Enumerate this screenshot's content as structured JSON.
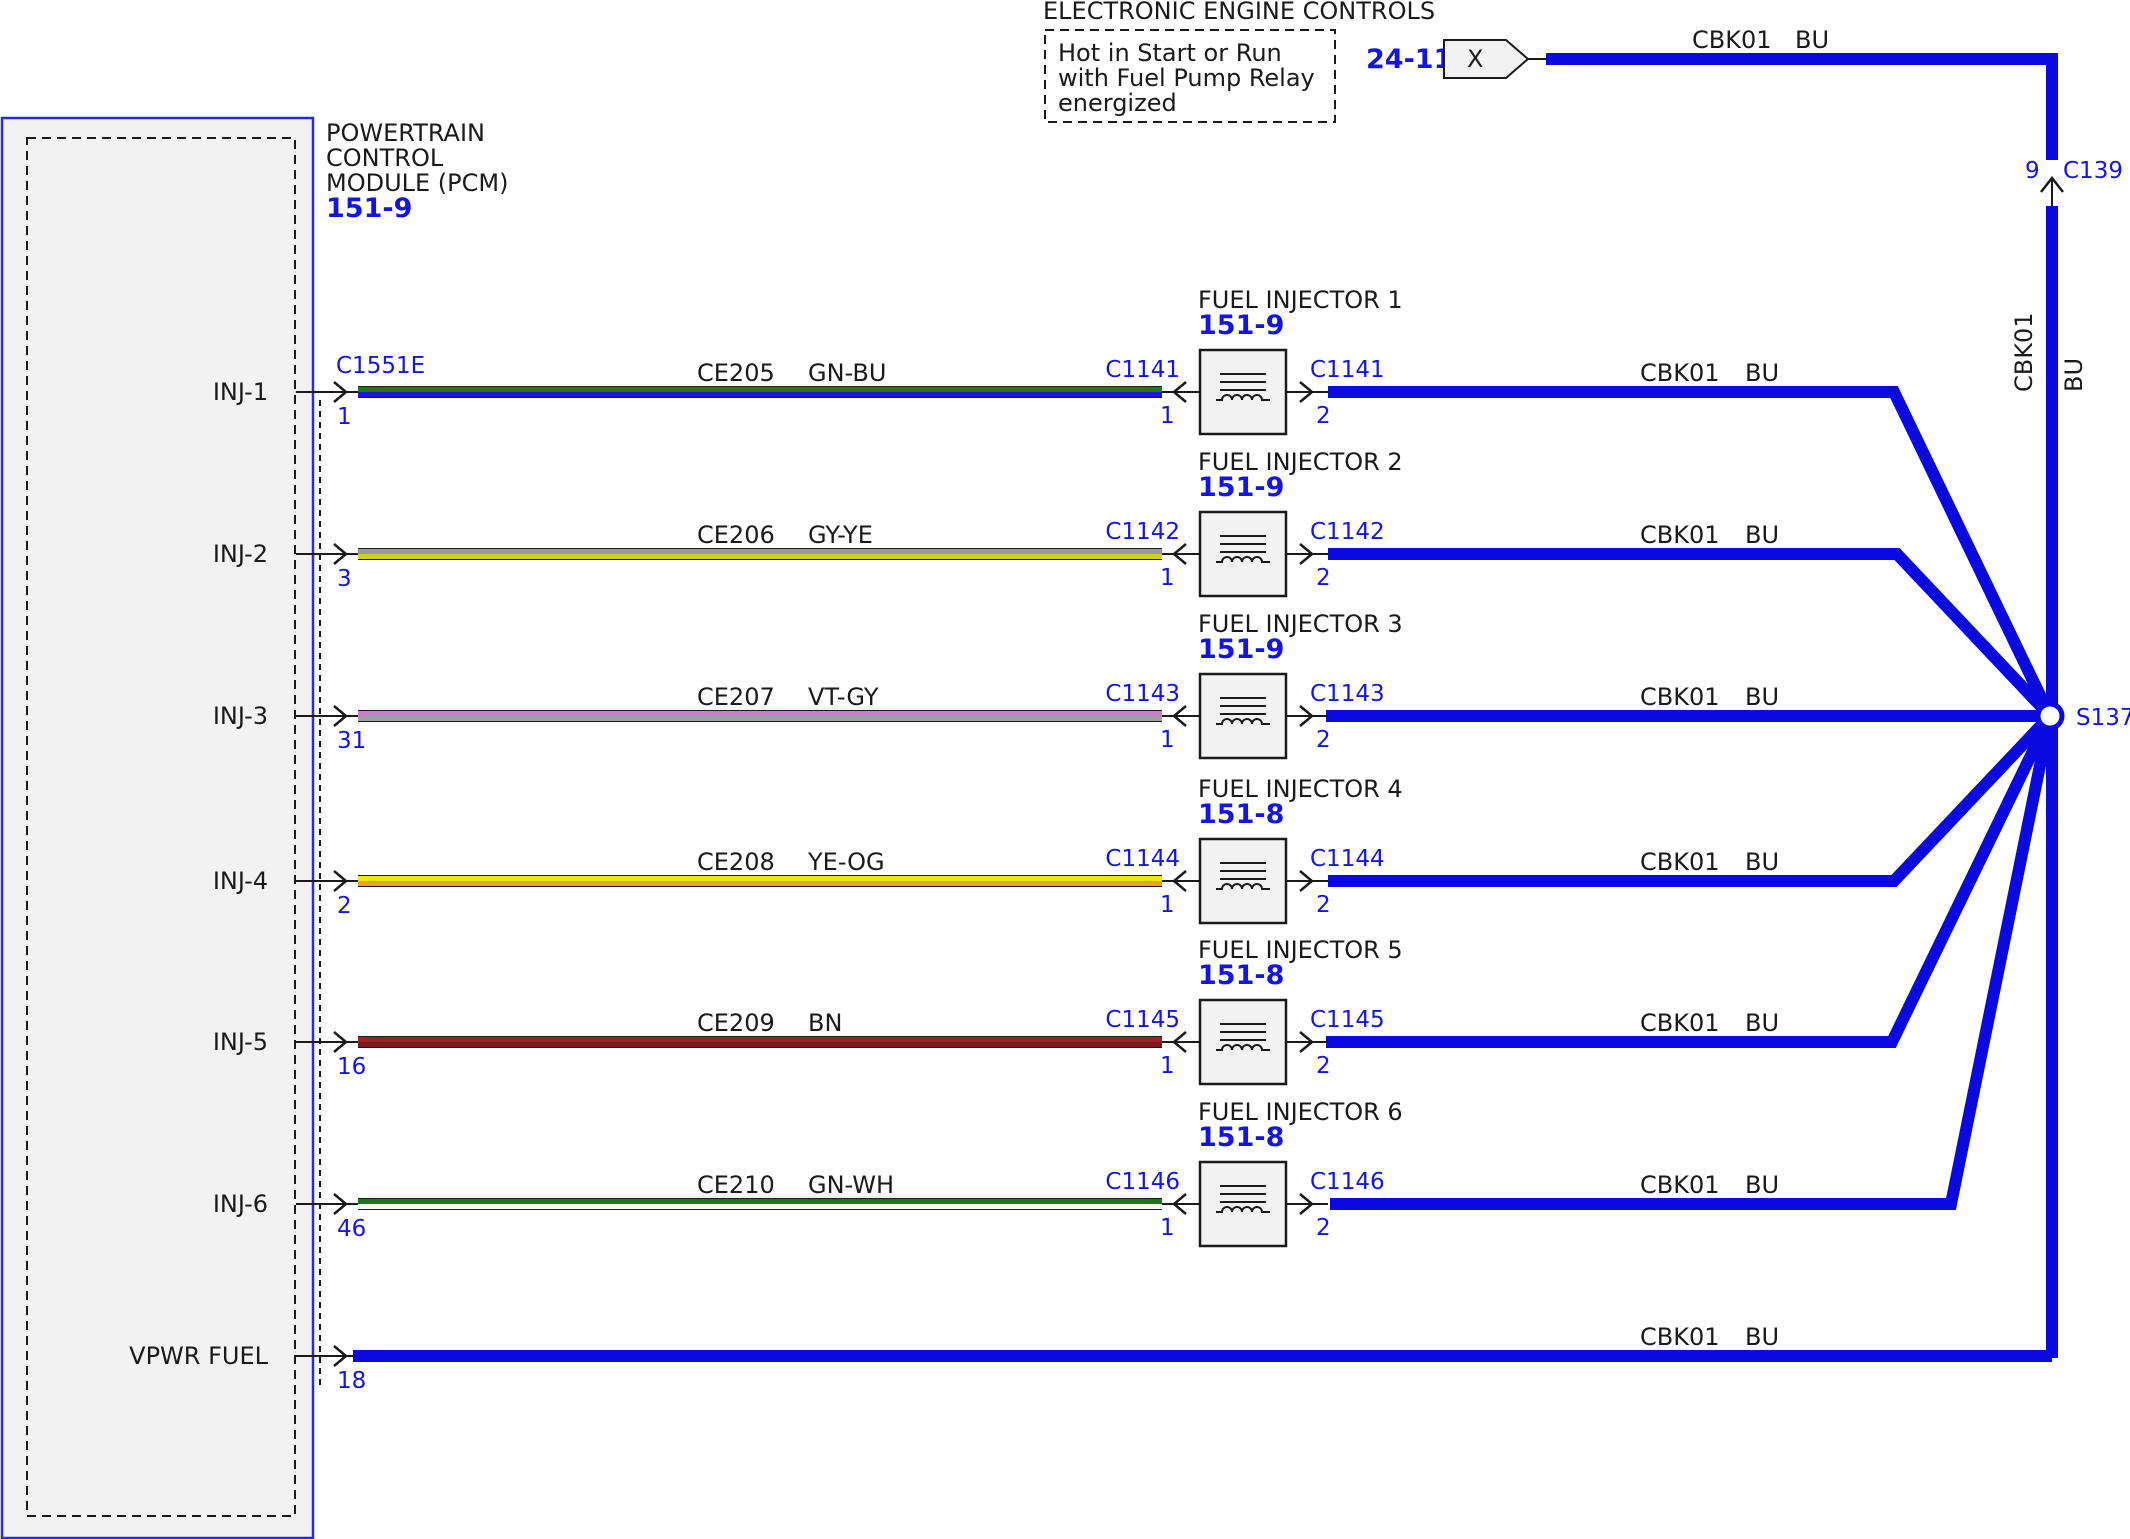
{
  "colors": {
    "wire_blue": "#0a0ae0",
    "label_blue": "#1414e6",
    "pcm_border": "#2b2bd6",
    "module_fill": "#f2f2f2",
    "GN-BU": [
      "#1a7a1a",
      "#1a1ad0"
    ],
    "GY-YE": [
      "#9a9a9a",
      "#d4cc2a"
    ],
    "VT-GY": [
      "#d07ad0",
      "#a0a0a0"
    ],
    "YE-OG": [
      "#f0e614",
      "#f0a020"
    ],
    "BN": [
      "#9a2222",
      "#7a1a1a"
    ],
    "GN-WH": [
      "#1a7a1a",
      "#ffffff"
    ]
  },
  "top": {
    "section_title": "ELECTRONIC ENGINE CONTROLS",
    "note_lines": [
      "Hot in Start or Run",
      "with Fuel Pump Relay",
      "energized"
    ],
    "ref": "24-11",
    "connector_symbol": "X",
    "wire_circuit": "CBK01",
    "wire_color": "BU"
  },
  "c139": {
    "pin": "9",
    "name": "C139"
  },
  "vertical_wire": {
    "circuit": "CBK01",
    "color": "BU"
  },
  "splice": {
    "name": "S137"
  },
  "pcm": {
    "title_lines": [
      "POWERTRAIN",
      "CONTROL",
      "MODULE (PCM)"
    ],
    "ref": "151-9",
    "connector": "C1551E"
  },
  "injectors": [
    {
      "pcm_label": "INJ-1",
      "pcm_pin": "1",
      "circuit": "CE205",
      "color": "GN-BU",
      "connector": "C1141",
      "title": "FUEL INJECTOR 1",
      "ref": "151-9",
      "pin_in": "1",
      "pin_out": "2",
      "out_circuit": "CBK01",
      "out_color": "BU"
    },
    {
      "pcm_label": "INJ-2",
      "pcm_pin": "3",
      "circuit": "CE206",
      "color": "GY-YE",
      "connector": "C1142",
      "title": "FUEL INJECTOR 2",
      "ref": "151-9",
      "pin_in": "1",
      "pin_out": "2",
      "out_circuit": "CBK01",
      "out_color": "BU"
    },
    {
      "pcm_label": "INJ-3",
      "pcm_pin": "31",
      "circuit": "CE207",
      "color": "VT-GY",
      "connector": "C1143",
      "title": "FUEL INJECTOR 3",
      "ref": "151-9",
      "pin_in": "1",
      "pin_out": "2",
      "out_circuit": "CBK01",
      "out_color": "BU"
    },
    {
      "pcm_label": "INJ-4",
      "pcm_pin": "2",
      "circuit": "CE208",
      "color": "YE-OG",
      "connector": "C1144",
      "title": "FUEL INJECTOR 4",
      "ref": "151-8",
      "pin_in": "1",
      "pin_out": "2",
      "out_circuit": "CBK01",
      "out_color": "BU"
    },
    {
      "pcm_label": "INJ-5",
      "pcm_pin": "16",
      "circuit": "CE209",
      "color": "BN",
      "connector": "C1145",
      "title": "FUEL INJECTOR 5",
      "ref": "151-8",
      "pin_in": "1",
      "pin_out": "2",
      "out_circuit": "CBK01",
      "out_color": "BU"
    },
    {
      "pcm_label": "INJ-6",
      "pcm_pin": "46",
      "circuit": "CE210",
      "color": "GN-WH",
      "connector": "C1146",
      "title": "FUEL INJECTOR 6",
      "ref": "151-8",
      "pin_in": "1",
      "pin_out": "2",
      "out_circuit": "CBK01",
      "out_color": "BU"
    }
  ],
  "vpwr": {
    "label": "VPWR FUEL",
    "pin": "18",
    "circuit": "CBK01",
    "color": "BU"
  }
}
